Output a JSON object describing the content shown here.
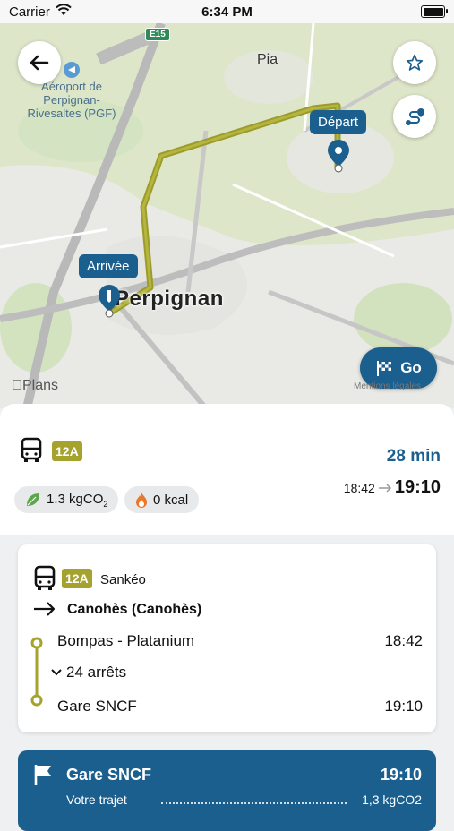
{
  "status_bar": {
    "carrier": "Carrier",
    "time": "6:34 PM"
  },
  "map": {
    "airport_label": "Aéroport de Perpignan-Rivesaltes (PGF)",
    "town": "Pia",
    "city": "Perpignan",
    "road": "E15",
    "depart_label": "Départ",
    "arrive_label": "Arrivée",
    "provider": "Plans",
    "legal": "Mentions légales",
    "go_label": "Go"
  },
  "summary": {
    "line": "12A",
    "duration": "28 min",
    "depart_time": "18:42",
    "arrive_time": "19:10",
    "co2_value": "1.3 kgCO",
    "co2_sub": "2",
    "kcal": "0 kcal"
  },
  "leg": {
    "line": "12A",
    "operator": "Sankéo",
    "direction": "Canohès (Canohès)",
    "from_stop": "Bompas - Platanium",
    "from_time": "18:42",
    "stops": "24 arrêts",
    "to_stop": "Gare SNCF",
    "to_time": "19:10"
  },
  "destination": {
    "name": "Gare SNCF",
    "time": "19:10",
    "summary_label": "Votre trajet",
    "summary_value": "1,3 kgCO2"
  },
  "colors": {
    "primary": "#1b5f8f",
    "line_12A": "#a5a32e",
    "route": "#9c9c2a"
  },
  "icons": [
    "back-arrow-icon",
    "favorite-star-icon",
    "route-icon",
    "bus-icon",
    "leaf-icon",
    "flame-icon",
    "arrow-right-icon",
    "chevron-down-icon",
    "flag-icon",
    "checkered-flag-icon"
  ]
}
